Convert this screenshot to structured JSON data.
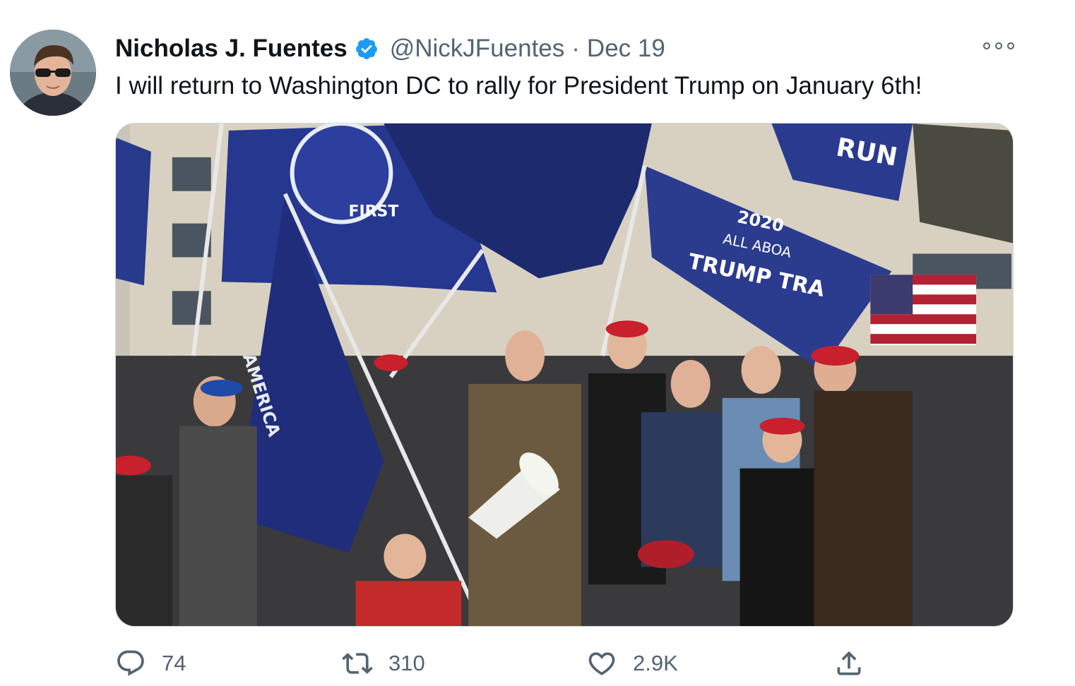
{
  "tweet": {
    "display_name": "Nicholas J. Fuentes",
    "verified": true,
    "handle": "@NickJFuentes",
    "separator": "·",
    "date": "Dec 19",
    "text": "I will return to Washington DC to rally for President Trump on January 6th!"
  },
  "media": {
    "flag_text_first": "FIRST",
    "flag_text_america": "AMERICA",
    "flag_text_trump": "TRUMP TRA",
    "flag_text_year": "2020",
    "flag_text_allaboard": "ALL ABOA",
    "flag_text_run": "RUN"
  },
  "actions": {
    "reply_count": "74",
    "retweet_count": "310",
    "like_count": "2.9K"
  },
  "icons": [
    "avatar",
    "verified-badge-icon",
    "more-options-icon",
    "reply-icon",
    "retweet-icon",
    "like-icon",
    "share-icon"
  ],
  "colors": {
    "accent": "#1d9bf0",
    "text_primary": "#0f1419",
    "text_secondary": "#536471"
  }
}
